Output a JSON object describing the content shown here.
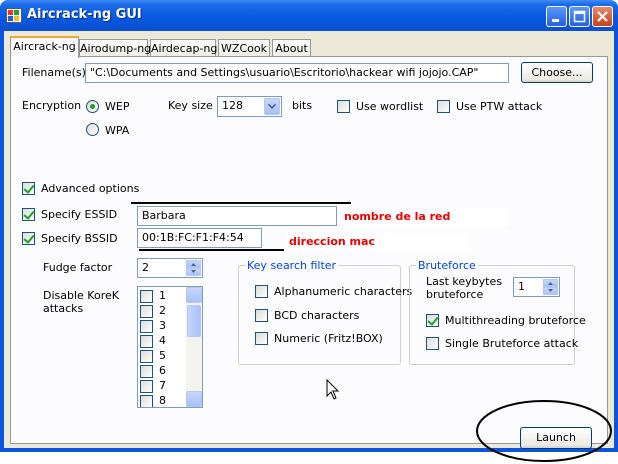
{
  "window": {
    "title": "Aircrack-ng GUI"
  },
  "tabs": [
    {
      "label": "Aircrack-ng",
      "active": true
    },
    {
      "label": "Airodump-ng",
      "active": false
    },
    {
      "label": "Airdecap-ng",
      "active": false
    },
    {
      "label": "WZCook",
      "active": false
    },
    {
      "label": "About",
      "active": false
    }
  ],
  "filename": {
    "label": "Filename(s)",
    "value": "\"C:\\Documents and Settings\\usuario\\Escritorio\\hackear wifi jojojo.CAP\"",
    "choose_label": "Choose..."
  },
  "encryption": {
    "label": "Encryption",
    "options": [
      {
        "label": "WEP",
        "selected": true
      },
      {
        "label": "WPA",
        "selected": false
      }
    ],
    "keysize_label": "Key size",
    "keysize_value": "128",
    "bits_label": "bits",
    "use_wordlist": {
      "label": "Use wordlist",
      "checked": false
    },
    "use_ptw": {
      "label": "Use PTW attack",
      "checked": false
    }
  },
  "advanced": {
    "label": "Advanced options",
    "checked": true,
    "essid": {
      "label": "Specify ESSID",
      "checked": true,
      "value": "Barbara",
      "note": "nombre de la red"
    },
    "bssid": {
      "label": "Specify BSSID",
      "checked": true,
      "value": "00:1B:FC:F1:F4:54",
      "note": "direccion mac"
    },
    "fudge": {
      "label": "Fudge factor",
      "value": "2"
    },
    "korek": {
      "label": "Disable KoreK attacks",
      "items": [
        {
          "label": "1",
          "checked": false
        },
        {
          "label": "2",
          "checked": false
        },
        {
          "label": "3",
          "checked": false
        },
        {
          "label": "4",
          "checked": false
        },
        {
          "label": "5",
          "checked": false
        },
        {
          "label": "6",
          "checked": false
        },
        {
          "label": "7",
          "checked": false
        },
        {
          "label": "8",
          "checked": false
        }
      ]
    }
  },
  "key_search_filter": {
    "title": "Key search filter",
    "items": [
      {
        "label": "Alphanumeric characters",
        "checked": false
      },
      {
        "label": "BCD characters",
        "checked": false
      },
      {
        "label": "Numeric (Fritz!BOX)",
        "checked": false
      }
    ]
  },
  "bruteforce": {
    "title": "Bruteforce",
    "last_keybytes_label": "Last keybytes\nbruteforce",
    "last_keybytes_value": "1",
    "multithreading": {
      "label": "Multithreading bruteforce",
      "checked": true
    },
    "single": {
      "label": "Single Bruteforce attack",
      "checked": false
    }
  },
  "launch_label": "Launch",
  "colors": {
    "titlebar": "#0a55dc",
    "annotation": "#e60000",
    "face": "#ece9d8"
  }
}
